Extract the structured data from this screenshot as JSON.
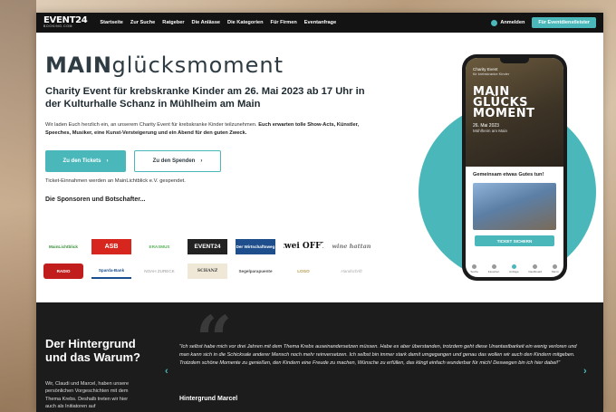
{
  "header": {
    "logo_main": "EVENT24",
    "logo_sub": "BOOKING.COM",
    "nav": [
      "Startseite",
      "Zur Suche",
      "Ratgeber",
      "Die Anlässe",
      "Die Kategorien",
      "Für Firmen",
      "Eventanfrage"
    ],
    "login": "Anmelden",
    "cta": "Für Eventdienstleister"
  },
  "hero": {
    "brand_bold": "MAIN",
    "brand_light": "glücksmoment",
    "headline": "Charity Event für krebskranke Kinder am 26. Mai 2023 ab 17 Uhr in der Kulturhalle Schanz in Mühlheim am Main",
    "intro_plain": "Wir laden Euch herzlich ein, an unserem Charity Event für krebskranke Kinder teilzunehmen. ",
    "intro_bold": "Euch erwarten tolle Show-Acts, Künstler, Speeches, Musiker, eine Kunst-Versteigerung und ein Abend für den guten Zweck.",
    "btn_tickets": "Zu den Tickets",
    "btn_donate": "Zu den Spenden",
    "tickets_note": "Ticket-Einnahmen werden an MainLichtblick e.V. gespendet.",
    "sponsor_title": "Die Sponsoren und Botschafter..."
  },
  "sponsors": [
    "MainLichtblick",
    "ASB",
    "ERASMUS",
    "EVENT24",
    "Der Wirtschaftsweg",
    "zwei OFFT",
    "wine hattan",
    "RADIO",
    "Sparda-Bank",
    "NOAH ZURECK",
    "SCHANZ",
    "Segelparapuente",
    "LOGO",
    "Handschrift"
  ],
  "phone": {
    "label": "Charity Event",
    "sub": "für krebskranke Kinder",
    "brand": [
      "MAIN",
      "GLÜCKS",
      "MOMENT"
    ],
    "date": "26. Mai 2023",
    "location": "Mühlheim am Main",
    "together": "Gemeinsam etwas Gutes tun!",
    "ticket_btn": "TICKET SICHERN",
    "tabs": [
      "Suche",
      "Favoriten",
      "Anfrage",
      "Dashboard",
      "Menü"
    ]
  },
  "background": {
    "title": "Der Hintergrund und das Warum?",
    "text": "Wir, Claudi und Marcel, haben unsere persönlichen Vorgeschichten mit dem Thema Krebs. Deshalb treten wir hier auch als Initiatoren auf",
    "quote": "\"Ich selbst habe mich vor drei Jahren mit dem Thema Krebs auseinandersetzen müssen. Habe es aber überstanden, trotzdem geht diese Unantastbarkeit ein wenig verloren und man kann sich in die Schicksale anderer Mensch noch mehr reinversetzen. Ich selbst bin immer stark damit umgegangen und genau das wollen wir auch den Kindern mitgeben. Trotzdem schöne Momente zu genießen, den Kindern eine Freude zu machen, Wünsche zu erfüllen, das klingt einfach wunderbar für mich! Deswegen bin ich hier dabei!\"",
    "quote_author": "Hintergrund Marcel"
  },
  "colors": {
    "accent": "#4ab8ba",
    "dark": "#1c1c1c",
    "topbar": "#131313"
  }
}
